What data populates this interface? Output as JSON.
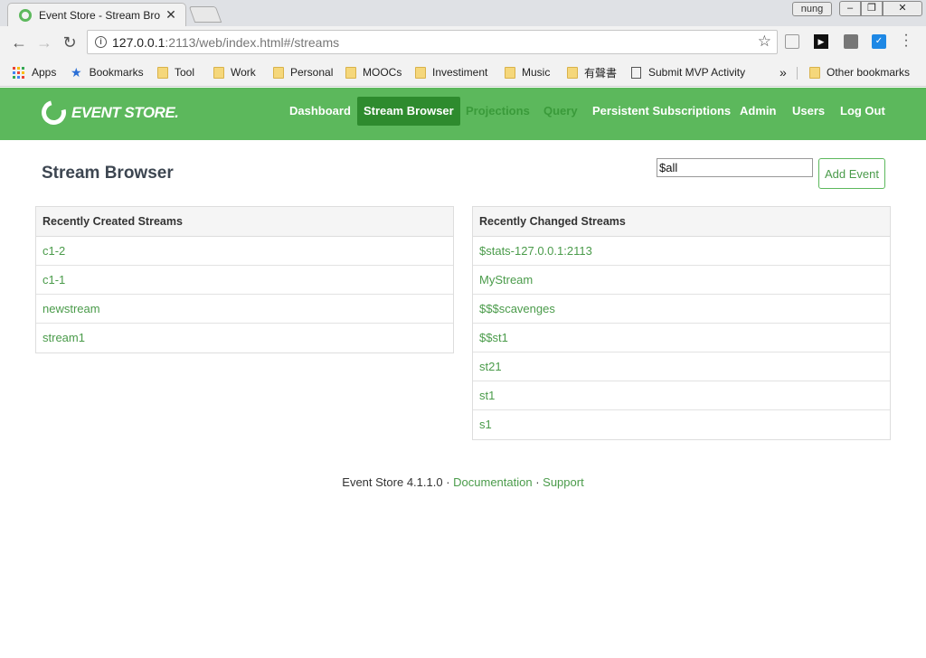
{
  "browser": {
    "tab_title": "Event Store - Stream Bro",
    "user_badge": "nung",
    "url_host": "127.0.0.1",
    "url_rest": ":2113/web/index.html#/streams",
    "ext_play_label": "▶",
    "ext_pocket_label": "✓",
    "bookmarks": {
      "apps": "Apps",
      "bookmarks": "Bookmarks",
      "tool": "Tool",
      "work": "Work",
      "personal": "Personal",
      "moocs": "MOOCs",
      "investiment": "Investiment",
      "music": "Music",
      "chinese": "有聲書",
      "mvp": "Submit MVP Activity",
      "overflow": "»",
      "other": "Other bookmarks"
    },
    "apps_colors": [
      "#ea4335",
      "#fbbc05",
      "#34a853",
      "#4285f4",
      "#ea4335",
      "#fbbc05",
      "#34a853",
      "#4285f4",
      "#ea4335"
    ]
  },
  "header": {
    "logo_text": "EVENT STORE.",
    "nav": {
      "dashboard": "Dashboard",
      "stream_browser": "Stream Browser",
      "projections": "Projections",
      "query": "Query",
      "persistent": "Persistent Subscriptions",
      "admin": "Admin",
      "users": "Users",
      "logout": "Log Out"
    },
    "accent_color": "#5cb85c"
  },
  "main": {
    "title": "Stream Browser",
    "stream_input_value": "$all",
    "add_event_label": "Add Event",
    "recently_created": {
      "title": "Recently Created Streams",
      "items": [
        "c1-2",
        "c1-1",
        "newstream",
        "stream1"
      ]
    },
    "recently_changed": {
      "title": "Recently Changed Streams",
      "items": [
        "$stats-127.0.0.1:2113",
        "MyStream",
        "$$$scavenges",
        "$$st1",
        "st21",
        "st1",
        "s1"
      ]
    }
  },
  "footer": {
    "version": "Event Store 4.1.1.0",
    "sep": " · ",
    "documentation": "Documentation",
    "support": "Support"
  }
}
